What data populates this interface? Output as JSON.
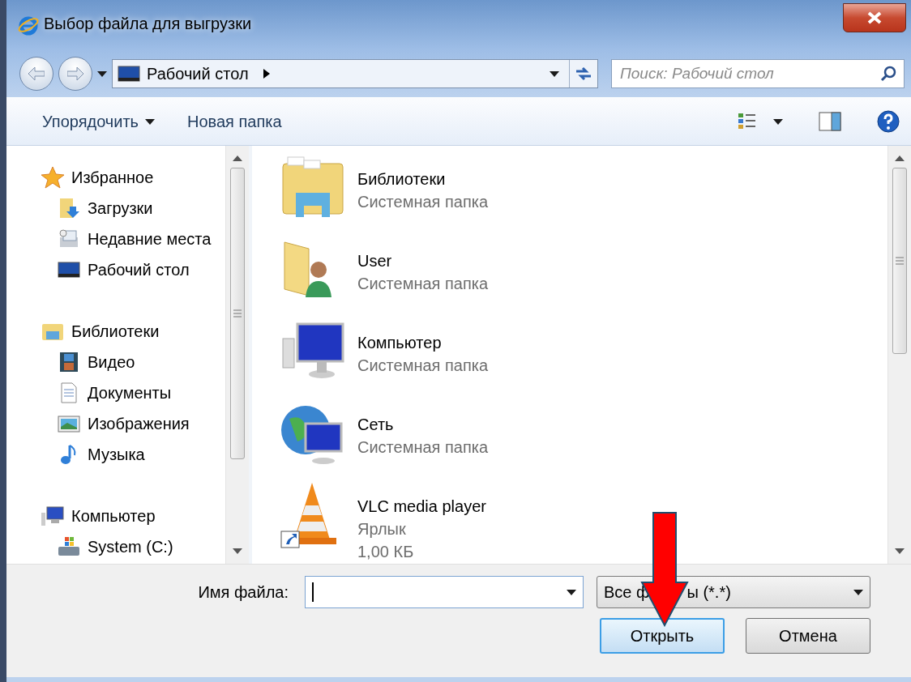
{
  "window": {
    "title": "Выбор файла для выгрузки"
  },
  "address_bar": {
    "path": "Рабочий стол"
  },
  "search": {
    "placeholder": "Поиск: Рабочий стол"
  },
  "toolbar": [
    {
      "label": "Упорядочить",
      "kind": "menu"
    },
    {
      "label": "Новая папка",
      "kind": "button"
    }
  ],
  "navigation": [
    {
      "label": "Избранное",
      "children": [
        {
          "label": "Загрузки"
        },
        {
          "label": "Недавние места"
        },
        {
          "label": "Рабочий стол"
        }
      ]
    },
    {
      "label": "Библиотеки",
      "children": [
        {
          "label": "Видео"
        },
        {
          "label": "Документы"
        },
        {
          "label": "Изображения"
        },
        {
          "label": "Музыка"
        }
      ]
    },
    {
      "label": "Компьютер",
      "children": [
        {
          "label": "System (C:)"
        }
      ]
    }
  ],
  "files": [
    {
      "name": "Библиотеки",
      "details": [
        "Системная папка"
      ]
    },
    {
      "name": "User",
      "details": [
        "Системная папка"
      ]
    },
    {
      "name": "Компьютер",
      "details": [
        "Системная папка"
      ]
    },
    {
      "name": "Сеть",
      "details": [
        "Системная папка"
      ]
    },
    {
      "name": "VLC media player",
      "details": [
        "Ярлык",
        "1,00 КБ"
      ]
    }
  ],
  "filename": {
    "label": "Имя файла:"
  },
  "filetype": {
    "visible_parts": [
      "Все ф",
      "ы (*.*)"
    ]
  },
  "buttons": [
    {
      "label": "Открыть",
      "default": true
    },
    {
      "label": "Отмена",
      "default": false
    }
  ]
}
